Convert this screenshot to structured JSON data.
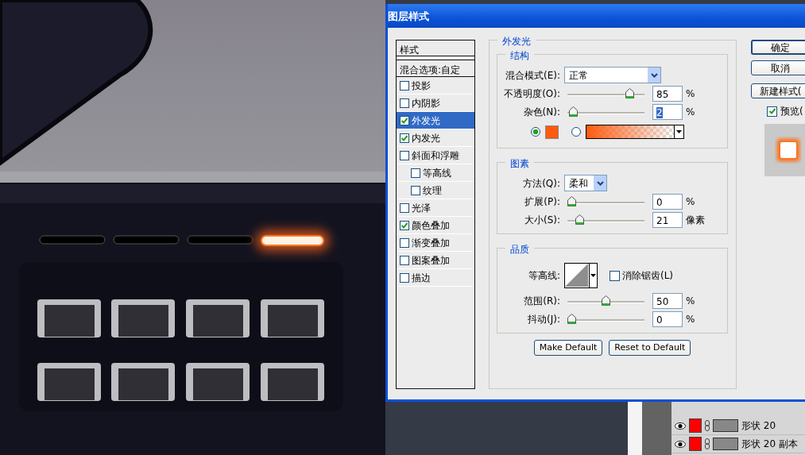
{
  "dialog": {
    "title": "图层样式",
    "styles_panel": {
      "header": "样式",
      "blend_options": "混合选项:自定",
      "items": [
        {
          "label": "投影",
          "checked": false,
          "selected": false
        },
        {
          "label": "内阴影",
          "checked": false,
          "selected": false
        },
        {
          "label": "外发光",
          "checked": true,
          "selected": true
        },
        {
          "label": "内发光",
          "checked": true,
          "selected": false
        },
        {
          "label": "斜面和浮雕",
          "checked": false,
          "selected": false,
          "children": [
            {
              "label": "等高线",
              "checked": false,
              "selected": false
            },
            {
              "label": "纹理",
              "checked": false,
              "selected": false
            }
          ]
        },
        {
          "label": "光泽",
          "checked": false,
          "selected": false
        },
        {
          "label": "颜色叠加",
          "checked": true,
          "selected": false
        },
        {
          "label": "渐变叠加",
          "checked": false,
          "selected": false
        },
        {
          "label": "图案叠加",
          "checked": false,
          "selected": false
        },
        {
          "label": "描边",
          "checked": false,
          "selected": false
        }
      ]
    },
    "section_title": "外发光",
    "structure": {
      "title": "结构",
      "blend_mode": {
        "label": "混合模式(E):",
        "value": "正常"
      },
      "opacity": {
        "label": "不透明度(O):",
        "level": 0.85,
        "value": "85",
        "unit": "%"
      },
      "noise": {
        "label": "杂色(N):",
        "level": 0.02,
        "value": "2",
        "unit": "%"
      },
      "color_option": {
        "selected": true,
        "color": "#ff5a10"
      },
      "gradient_option": {
        "selected": false
      }
    },
    "elements": {
      "title": "图素",
      "technique": {
        "label": "方法(Q):",
        "value": "柔和"
      },
      "spread": {
        "label": "扩展(P):",
        "level": 0,
        "value": "0",
        "unit": "%"
      },
      "size": {
        "label": "大小(S):",
        "level": 0.12,
        "value": "21",
        "unit": "像素"
      }
    },
    "quality": {
      "title": "品质",
      "contour": {
        "label": "等高线:"
      },
      "anti_alias": {
        "label": "消除锯齿(L)",
        "checked": false
      },
      "range": {
        "label": "范围(R):",
        "level": 0.5,
        "value": "50",
        "unit": "%"
      },
      "jitter": {
        "label": "抖动(J):",
        "level": 0,
        "value": "0",
        "unit": "%"
      }
    },
    "default_buttons": [
      "Make Default",
      "Reset to Default"
    ],
    "buttons": [
      "确定",
      "取消",
      "新建样式("
    ],
    "preview": {
      "label": "预览(",
      "checked": true
    }
  },
  "layers": [
    {
      "name": "形状 20"
    },
    {
      "name": "形状 20 副本"
    }
  ]
}
